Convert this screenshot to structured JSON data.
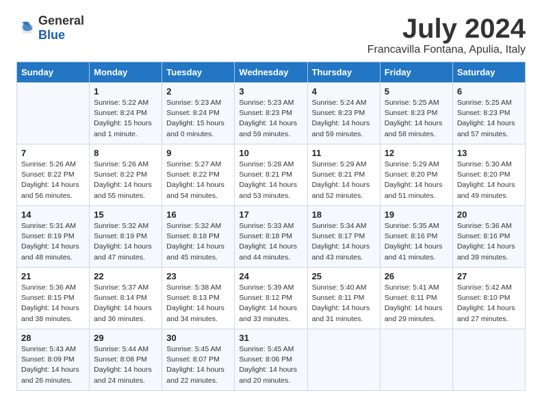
{
  "logo": {
    "general": "General",
    "blue": "Blue"
  },
  "title": "July 2024",
  "location": "Francavilla Fontana, Apulia, Italy",
  "days_of_week": [
    "Sunday",
    "Monday",
    "Tuesday",
    "Wednesday",
    "Thursday",
    "Friday",
    "Saturday"
  ],
  "weeks": [
    [
      {
        "day": "",
        "sunrise": "",
        "sunset": "",
        "daylight": ""
      },
      {
        "day": "1",
        "sunrise": "Sunrise: 5:22 AM",
        "sunset": "Sunset: 8:24 PM",
        "daylight": "Daylight: 15 hours and 1 minute."
      },
      {
        "day": "2",
        "sunrise": "Sunrise: 5:23 AM",
        "sunset": "Sunset: 8:24 PM",
        "daylight": "Daylight: 15 hours and 0 minutes."
      },
      {
        "day": "3",
        "sunrise": "Sunrise: 5:23 AM",
        "sunset": "Sunset: 8:23 PM",
        "daylight": "Daylight: 14 hours and 59 minutes."
      },
      {
        "day": "4",
        "sunrise": "Sunrise: 5:24 AM",
        "sunset": "Sunset: 8:23 PM",
        "daylight": "Daylight: 14 hours and 59 minutes."
      },
      {
        "day": "5",
        "sunrise": "Sunrise: 5:25 AM",
        "sunset": "Sunset: 8:23 PM",
        "daylight": "Daylight: 14 hours and 58 minutes."
      },
      {
        "day": "6",
        "sunrise": "Sunrise: 5:25 AM",
        "sunset": "Sunset: 8:23 PM",
        "daylight": "Daylight: 14 hours and 57 minutes."
      }
    ],
    [
      {
        "day": "7",
        "sunrise": "Sunrise: 5:26 AM",
        "sunset": "Sunset: 8:22 PM",
        "daylight": "Daylight: 14 hours and 56 minutes."
      },
      {
        "day": "8",
        "sunrise": "Sunrise: 5:26 AM",
        "sunset": "Sunset: 8:22 PM",
        "daylight": "Daylight: 14 hours and 55 minutes."
      },
      {
        "day": "9",
        "sunrise": "Sunrise: 5:27 AM",
        "sunset": "Sunset: 8:22 PM",
        "daylight": "Daylight: 14 hours and 54 minutes."
      },
      {
        "day": "10",
        "sunrise": "Sunrise: 5:28 AM",
        "sunset": "Sunset: 8:21 PM",
        "daylight": "Daylight: 14 hours and 53 minutes."
      },
      {
        "day": "11",
        "sunrise": "Sunrise: 5:29 AM",
        "sunset": "Sunset: 8:21 PM",
        "daylight": "Daylight: 14 hours and 52 minutes."
      },
      {
        "day": "12",
        "sunrise": "Sunrise: 5:29 AM",
        "sunset": "Sunset: 8:20 PM",
        "daylight": "Daylight: 14 hours and 51 minutes."
      },
      {
        "day": "13",
        "sunrise": "Sunrise: 5:30 AM",
        "sunset": "Sunset: 8:20 PM",
        "daylight": "Daylight: 14 hours and 49 minutes."
      }
    ],
    [
      {
        "day": "14",
        "sunrise": "Sunrise: 5:31 AM",
        "sunset": "Sunset: 8:19 PM",
        "daylight": "Daylight: 14 hours and 48 minutes."
      },
      {
        "day": "15",
        "sunrise": "Sunrise: 5:32 AM",
        "sunset": "Sunset: 8:19 PM",
        "daylight": "Daylight: 14 hours and 47 minutes."
      },
      {
        "day": "16",
        "sunrise": "Sunrise: 5:32 AM",
        "sunset": "Sunset: 8:18 PM",
        "daylight": "Daylight: 14 hours and 45 minutes."
      },
      {
        "day": "17",
        "sunrise": "Sunrise: 5:33 AM",
        "sunset": "Sunset: 8:18 PM",
        "daylight": "Daylight: 14 hours and 44 minutes."
      },
      {
        "day": "18",
        "sunrise": "Sunrise: 5:34 AM",
        "sunset": "Sunset: 8:17 PM",
        "daylight": "Daylight: 14 hours and 43 minutes."
      },
      {
        "day": "19",
        "sunrise": "Sunrise: 5:35 AM",
        "sunset": "Sunset: 8:16 PM",
        "daylight": "Daylight: 14 hours and 41 minutes."
      },
      {
        "day": "20",
        "sunrise": "Sunrise: 5:36 AM",
        "sunset": "Sunset: 8:16 PM",
        "daylight": "Daylight: 14 hours and 39 minutes."
      }
    ],
    [
      {
        "day": "21",
        "sunrise": "Sunrise: 5:36 AM",
        "sunset": "Sunset: 8:15 PM",
        "daylight": "Daylight: 14 hours and 38 minutes."
      },
      {
        "day": "22",
        "sunrise": "Sunrise: 5:37 AM",
        "sunset": "Sunset: 8:14 PM",
        "daylight": "Daylight: 14 hours and 36 minutes."
      },
      {
        "day": "23",
        "sunrise": "Sunrise: 5:38 AM",
        "sunset": "Sunset: 8:13 PM",
        "daylight": "Daylight: 14 hours and 34 minutes."
      },
      {
        "day": "24",
        "sunrise": "Sunrise: 5:39 AM",
        "sunset": "Sunset: 8:12 PM",
        "daylight": "Daylight: 14 hours and 33 minutes."
      },
      {
        "day": "25",
        "sunrise": "Sunrise: 5:40 AM",
        "sunset": "Sunset: 8:11 PM",
        "daylight": "Daylight: 14 hours and 31 minutes."
      },
      {
        "day": "26",
        "sunrise": "Sunrise: 5:41 AM",
        "sunset": "Sunset: 8:11 PM",
        "daylight": "Daylight: 14 hours and 29 minutes."
      },
      {
        "day": "27",
        "sunrise": "Sunrise: 5:42 AM",
        "sunset": "Sunset: 8:10 PM",
        "daylight": "Daylight: 14 hours and 27 minutes."
      }
    ],
    [
      {
        "day": "28",
        "sunrise": "Sunrise: 5:43 AM",
        "sunset": "Sunset: 8:09 PM",
        "daylight": "Daylight: 14 hours and 26 minutes."
      },
      {
        "day": "29",
        "sunrise": "Sunrise: 5:44 AM",
        "sunset": "Sunset: 8:08 PM",
        "daylight": "Daylight: 14 hours and 24 minutes."
      },
      {
        "day": "30",
        "sunrise": "Sunrise: 5:45 AM",
        "sunset": "Sunset: 8:07 PM",
        "daylight": "Daylight: 14 hours and 22 minutes."
      },
      {
        "day": "31",
        "sunrise": "Sunrise: 5:45 AM",
        "sunset": "Sunset: 8:06 PM",
        "daylight": "Daylight: 14 hours and 20 minutes."
      },
      {
        "day": "",
        "sunrise": "",
        "sunset": "",
        "daylight": ""
      },
      {
        "day": "",
        "sunrise": "",
        "sunset": "",
        "daylight": ""
      },
      {
        "day": "",
        "sunrise": "",
        "sunset": "",
        "daylight": ""
      }
    ]
  ]
}
